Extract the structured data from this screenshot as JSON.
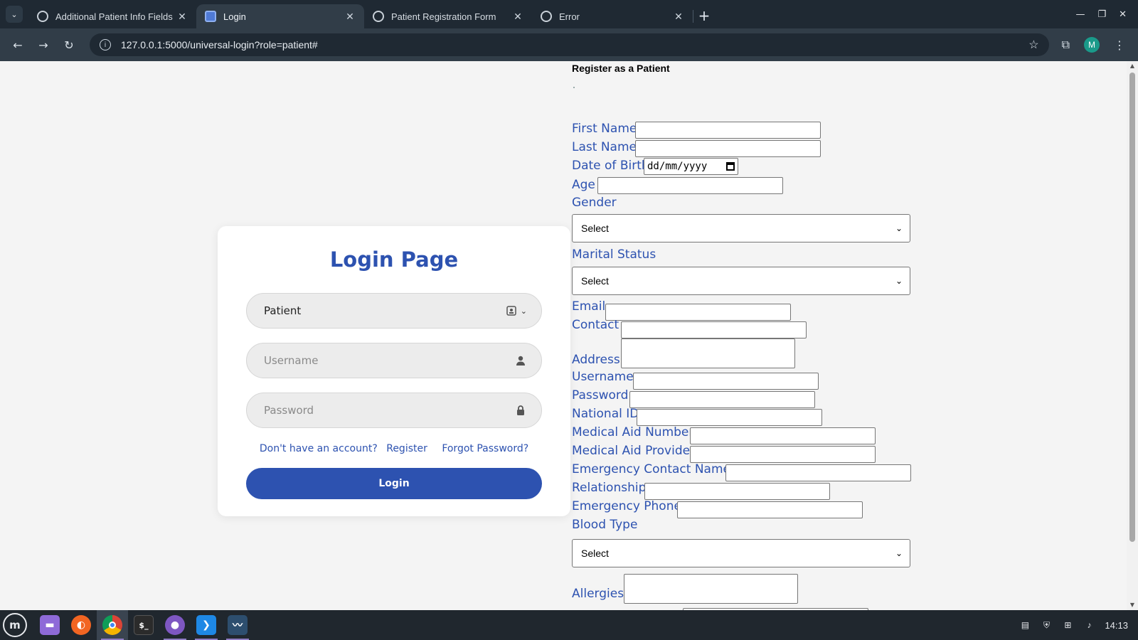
{
  "browser": {
    "tabs": [
      {
        "title": "Additional Patient Info Fields",
        "icon": "openai-icon",
        "active": false
      },
      {
        "title": "Login",
        "icon": "page-icon",
        "active": true
      },
      {
        "title": "Patient Registration Form",
        "icon": "globe-icon",
        "active": false
      },
      {
        "title": "Error",
        "icon": "globe-icon",
        "active": false
      }
    ],
    "url": "127.0.0.1:5000/universal-login?role=patient#",
    "profile_initial": "M"
  },
  "login": {
    "title": "Login Page",
    "role_value": "Patient",
    "username_placeholder": "Username",
    "password_placeholder": "Password",
    "no_account_text": "Don't have an account?",
    "register_link": "Register",
    "forgot_link": "Forgot Password?",
    "login_button": "Login"
  },
  "registration": {
    "title": "Register as a Patient",
    "labels": {
      "first_name": "First Name",
      "last_name": "Last Name",
      "dob": "Date of Birth",
      "age": "Age",
      "gender": "Gender",
      "marital_status": "Marital Status",
      "email": "Email",
      "contact": "Contact",
      "address": "Address",
      "username": "Username",
      "password": "Password",
      "national_id": "National ID",
      "medical_aid_number": "Medical Aid Number",
      "medical_aid_provider": "Medical Aid Provider",
      "emergency_contact_name": "Emergency Contact Name",
      "relationship": "Relationship",
      "emergency_phone": "Emergency Phone",
      "blood_type": "Blood Type",
      "allergies": "Allergies"
    },
    "dob_placeholder": "dd/mm/yyyy",
    "gender_value": "Select",
    "marital_value": "Select",
    "blood_value": "Select"
  },
  "taskbar": {
    "apps": [
      "files-icon",
      "firefox-icon",
      "chrome-icon",
      "terminal-icon",
      "github-desktop-icon",
      "vscode-icon",
      "mysql-workbench-icon"
    ],
    "clock": "14:13"
  },
  "colors": {
    "accent": "#2d52b0",
    "chrome_dark": "#1f2933",
    "chrome_toolbar": "#313d48"
  }
}
